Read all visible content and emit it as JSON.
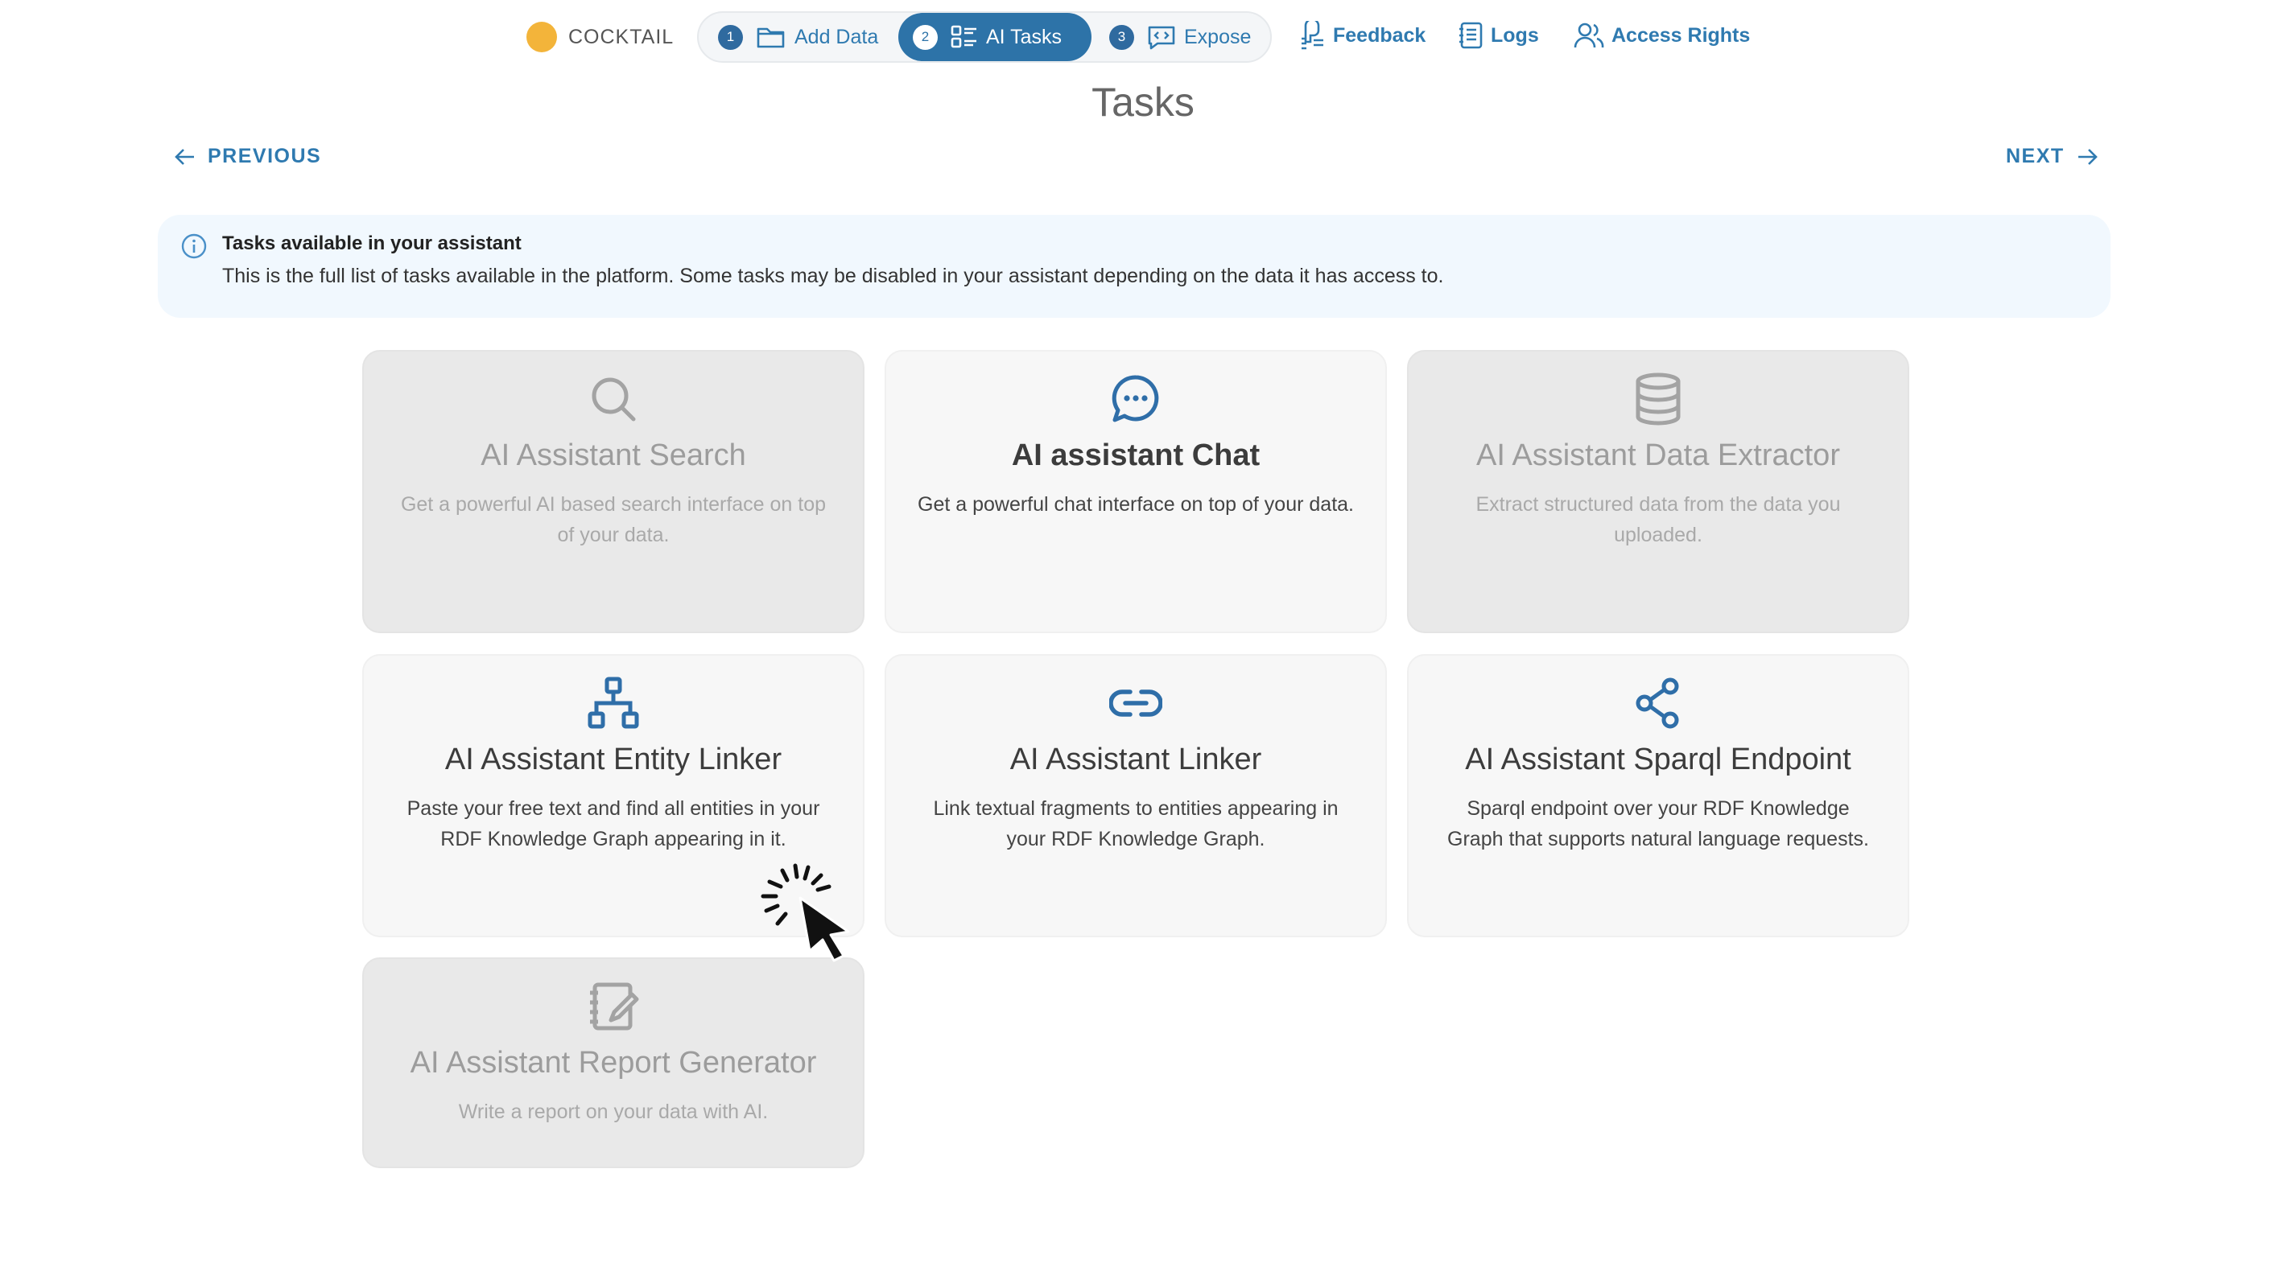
{
  "brand": {
    "name": "COCKTAIL",
    "dot_color": "#f3b43a"
  },
  "stepper": {
    "steps": [
      {
        "num": "1",
        "label": "Add Data",
        "icon": "folder-icon"
      },
      {
        "num": "2",
        "label": "AI Tasks",
        "icon": "tasks-list-icon",
        "active": true
      },
      {
        "num": "3",
        "label": "Expose",
        "icon": "code-message-icon"
      }
    ]
  },
  "nav": {
    "feedback": "Feedback",
    "logs": "Logs",
    "access_rights": "Access Rights"
  },
  "page": {
    "title": "Tasks",
    "previous": "PREVIOUS",
    "next": "NEXT"
  },
  "info": {
    "title": "Tasks available in your assistant",
    "text": "This is the full list of tasks available in the platform. Some tasks may be disabled in your assistant depending on the data it has access to."
  },
  "cards": [
    {
      "title": "AI Assistant Search",
      "desc": "Get a powerful AI based search interface on top of your data.",
      "icon": "search-icon",
      "disabled": true
    },
    {
      "title": "AI assistant Chat",
      "desc": "Get a powerful chat interface on top of your data.",
      "icon": "chat-bubble-icon",
      "disabled": false
    },
    {
      "title": "AI Assistant Data Extractor",
      "desc": "Extract structured data from the data you uploaded.",
      "icon": "database-icon",
      "disabled": true
    },
    {
      "title": "AI Assistant Entity Linker",
      "desc": "Paste your free text and find all entities in your RDF Knowledge Graph appearing in it.",
      "icon": "hierarchy-icon",
      "disabled": false
    },
    {
      "title": "AI Assistant Linker",
      "desc": "Link textual fragments to entities appearing in your RDF Knowledge Graph.",
      "icon": "link-icon",
      "disabled": false
    },
    {
      "title": "AI Assistant Sparql Endpoint",
      "desc": "Sparql endpoint over your RDF Knowledge Graph that supports natural language requests.",
      "icon": "share-icon",
      "disabled": false
    },
    {
      "title": "AI Assistant Report Generator",
      "desc": "Write a report on your data with AI.",
      "icon": "notebook-edit-icon",
      "disabled": true
    }
  ],
  "colors": {
    "accent": "#2f7ab0",
    "active_step": "#2d73a8",
    "info_bg": "#f1f8fe",
    "disabled_card": "#e9e9e9"
  }
}
